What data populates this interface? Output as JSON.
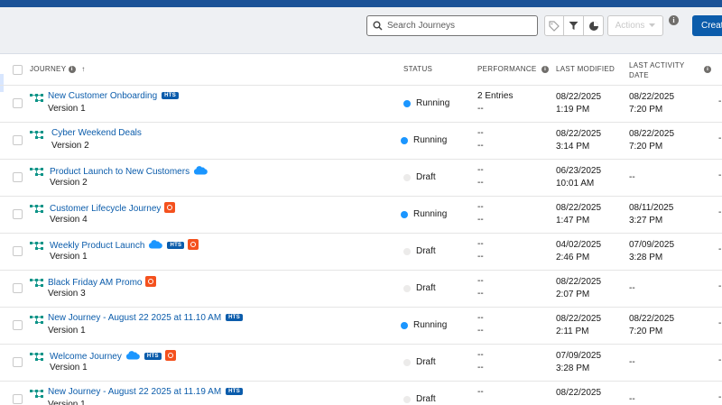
{
  "toolbar": {
    "search_placeholder": "Search Journeys",
    "actions_label": "Actions",
    "create_label": "Create"
  },
  "columns": {
    "journey": "JOURNEY",
    "status": "STATUS",
    "performance": "PERFORMANCE",
    "last_modified": "LAST MODIFIED",
    "last_activity_line1": "LAST ACTIVITY",
    "last_activity_line2": "DATE"
  },
  "badges": {
    "hts": "HTS"
  },
  "rows": [
    {
      "name": "New Customer Onboarding",
      "version": "Version 1",
      "status": "Running",
      "perf1": "2 Entries",
      "perf2": "--",
      "mod1": "08/22/2025",
      "mod2": "1:19 PM",
      "act1": "08/22/2025",
      "act2": "7:20 PM"
    },
    {
      "name": "Cyber Weekend Deals",
      "version": "Version 2",
      "status": "Running",
      "perf1": "--",
      "perf2": "--",
      "mod1": "08/22/2025",
      "mod2": "3:14 PM",
      "act1": "08/22/2025",
      "act2": "7:20 PM"
    },
    {
      "name": "Product Launch to New Customers",
      "version": "Version 2",
      "status": "Draft",
      "perf1": "--",
      "perf2": "--",
      "mod1": "06/23/2025",
      "mod2": "10:01 AM",
      "act1": "--",
      "act2": ""
    },
    {
      "name": "Customer Lifecycle Journey",
      "version": "Version 4",
      "status": "Running",
      "perf1": "--",
      "perf2": "--",
      "mod1": "08/22/2025",
      "mod2": "1:47 PM",
      "act1": "08/11/2025",
      "act2": "3:27 PM"
    },
    {
      "name": "Weekly Product Launch",
      "version": "Version 1",
      "status": "Draft",
      "perf1": "--",
      "perf2": "--",
      "mod1": "04/02/2025",
      "mod2": "2:46 PM",
      "act1": "07/09/2025",
      "act2": "3:28 PM"
    },
    {
      "name": "Black Friday AM Promo",
      "version": "Version 3",
      "status": "Draft",
      "perf1": "--",
      "perf2": "--",
      "mod1": "08/22/2025",
      "mod2": "2:07 PM",
      "act1": "--",
      "act2": ""
    },
    {
      "name": "New Journey - August 22 2025 at 11.10 AM",
      "version": "Version 1",
      "status": "Running",
      "perf1": "--",
      "perf2": "--",
      "mod1": "08/22/2025",
      "mod2": "2:11 PM",
      "act1": "08/22/2025",
      "act2": "7:20 PM"
    },
    {
      "name": "Welcome Journey",
      "version": "Version 1",
      "status": "Draft",
      "perf1": "--",
      "perf2": "--",
      "mod1": "07/09/2025",
      "mod2": "3:28 PM",
      "act1": "--",
      "act2": ""
    },
    {
      "name": "New Journey - August 22 2025 at 11.19 AM",
      "version": "Version 1",
      "status": "Draft",
      "perf1": "--",
      "perf2": "",
      "mod1": "08/22/2025",
      "mod2": "",
      "act1": "--",
      "act2": ""
    }
  ],
  "edge_text": "-"
}
